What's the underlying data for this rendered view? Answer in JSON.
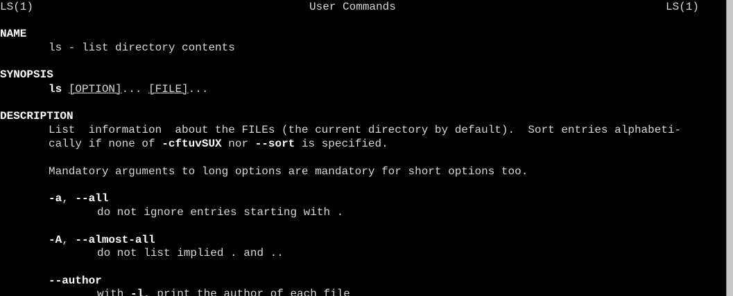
{
  "header": {
    "left": "LS(1)",
    "center": "User Commands",
    "right": "LS(1)"
  },
  "name_section": {
    "title": "NAME",
    "line": "ls - list directory contents"
  },
  "synopsis_section": {
    "title": "SYNOPSIS",
    "command": "ls",
    "sp1": " ",
    "option": "[OPTION]",
    "dots1": "... ",
    "file": "[FILE]",
    "dots2": "..."
  },
  "description_section": {
    "title": "DESCRIPTION",
    "para1_line1": "List  information  about the FILEs (the current directory by default).  Sort entries alphabeti-",
    "para1_line2_a": "cally if none of ",
    "para1_line2_flags": "-cftuvSUX",
    "para1_line2_b": " nor ",
    "para1_line2_sort": "--sort",
    "para1_line2_c": " is specified.",
    "para2": "Mandatory arguments to long options are mandatory for short options too."
  },
  "options": [
    {
      "short": "-a",
      "sep": ", ",
      "long": "--all",
      "desc": "do not ignore entries starting with ."
    },
    {
      "short": "-A",
      "sep": ", ",
      "long": "--almost-all",
      "desc": "do not list implied . and .."
    },
    {
      "long": "--author",
      "desc_a": "with ",
      "desc_flag": "-l",
      "desc_b": ", print the author of each file"
    }
  ]
}
